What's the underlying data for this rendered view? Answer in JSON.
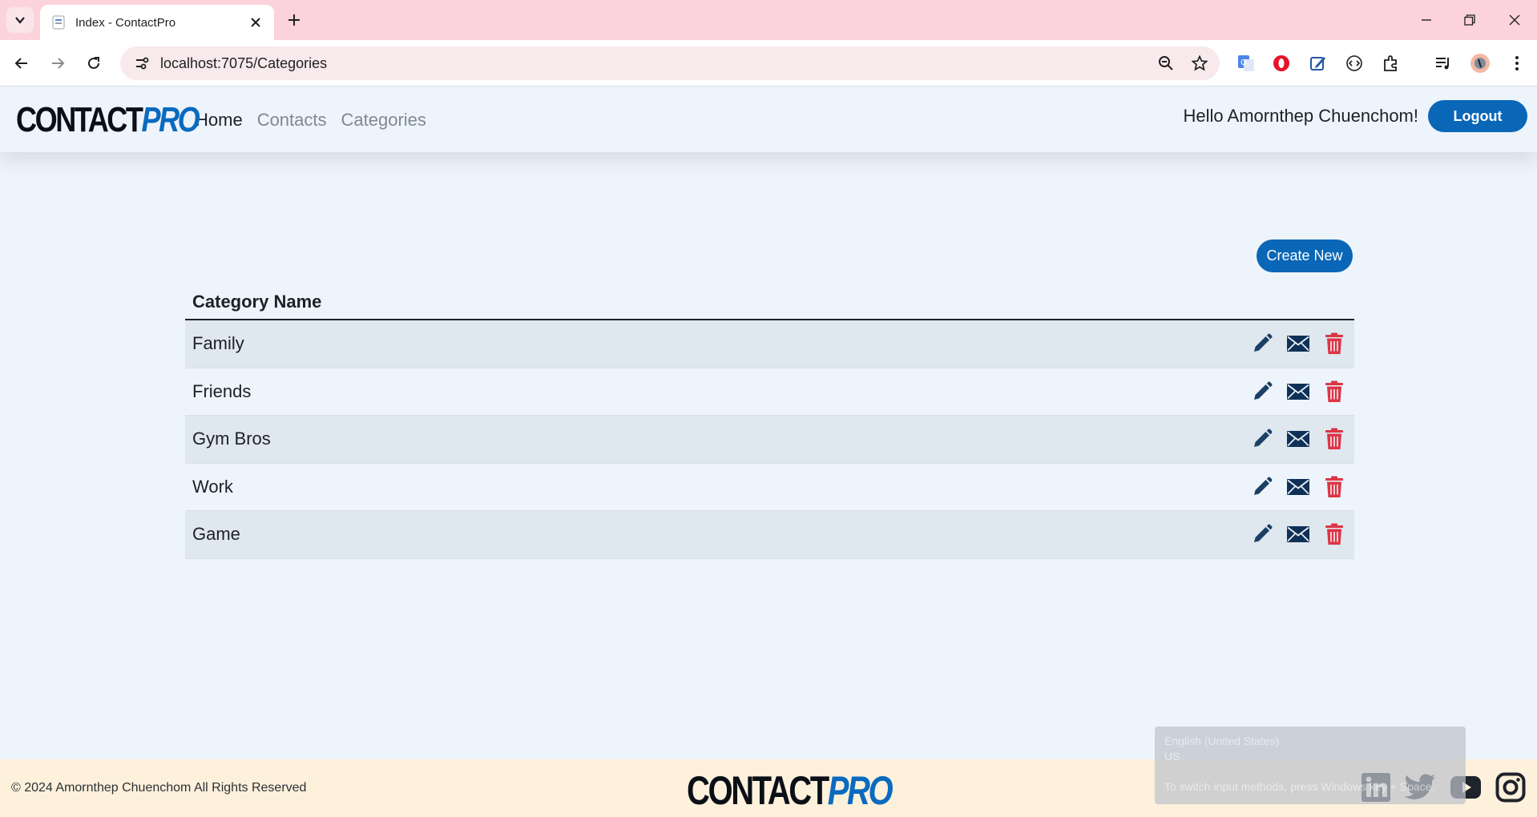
{
  "browser": {
    "tab_title": "Index - ContactPro",
    "url": "localhost:7075/Categories"
  },
  "nav": {
    "brand_part1": "CONTACT",
    "brand_part2": "PRO",
    "links": [
      "Home",
      "Contacts",
      "Categories"
    ],
    "greeting": "Hello Amornthep Chuenchom!",
    "logout_label": "Logout"
  },
  "main": {
    "create_label": "Create New",
    "column_header": "Category Name",
    "rows": [
      "Family",
      "Friends",
      "Gym Bros",
      "Work",
      "Game"
    ]
  },
  "footer": {
    "copyright": "© 2024 Amornthep Chuenchom All Rights Reserved",
    "brand_part1": "CONTACT",
    "brand_part2": "PRO",
    "socials": [
      "linkedin-icon",
      "twitter-icon",
      "youtube-icon",
      "instagram-icon"
    ]
  },
  "ime_toast": {
    "language": "English (United States)",
    "layout": "US",
    "hint": "To switch input methods, press Windows key + Space."
  },
  "colors": {
    "primary": "#0a66b7",
    "edit_icon": "#1c3f66",
    "mail_icon": "#0f3158",
    "delete_icon": "#dc3545",
    "page_bg": "#edf4fb",
    "footer_bg": "#fdf1dc",
    "tab_strip": "#fcd3dc"
  }
}
